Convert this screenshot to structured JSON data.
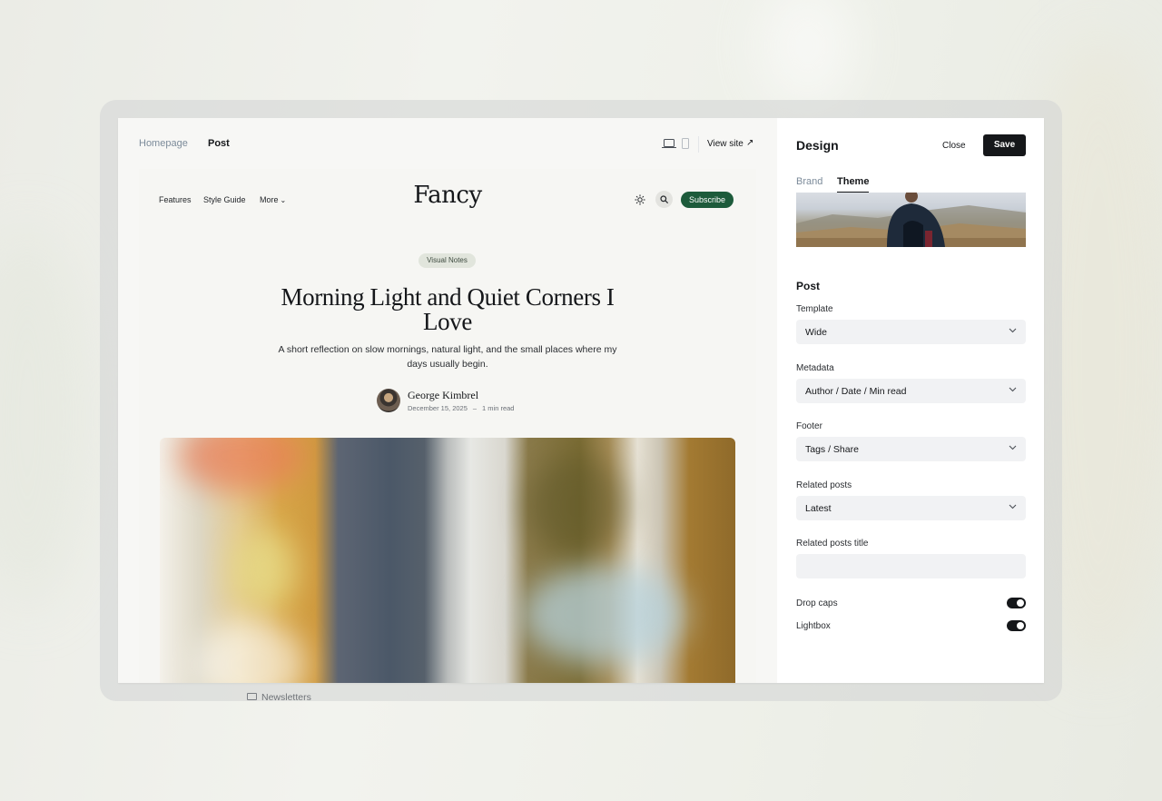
{
  "preview_topbar": {
    "tabs": [
      "Homepage",
      "Post"
    ],
    "view_site": "View site",
    "view_site_icon": "↗"
  },
  "site": {
    "logo": "Fancy",
    "nav": [
      "Features",
      "Style Guide",
      "More"
    ],
    "subscribe_label": "Subscribe",
    "post": {
      "tag": "Visual Notes",
      "title": "Morning Light and Quiet Corners I Love",
      "excerpt": "A short reflection on slow mornings, natural light, and the small places where my days usually begin.",
      "author": "George Kimbrel",
      "date": "December 15, 2025",
      "separator": "–",
      "read_time": "1 min read"
    }
  },
  "settings": {
    "title": "Design",
    "close_label": "Close",
    "save_label": "Save",
    "tabs": [
      "Brand",
      "Theme"
    ],
    "section_title": "Post",
    "fields": [
      {
        "label": "Template",
        "value": "Wide"
      },
      {
        "label": "Metadata",
        "value": "Author / Date / Min read"
      },
      {
        "label": "Footer",
        "value": "Tags / Share"
      },
      {
        "label": "Related posts",
        "value": "Latest"
      },
      {
        "label": "Related posts title",
        "value": ""
      }
    ],
    "toggles": [
      {
        "label": "Drop caps",
        "on": true
      },
      {
        "label": "Lightbox",
        "on": true
      }
    ]
  },
  "behind": {
    "newsletters_label": "Newsletters"
  },
  "colors": {
    "accent": "#1d5b3b",
    "save_button": "#15171a"
  }
}
